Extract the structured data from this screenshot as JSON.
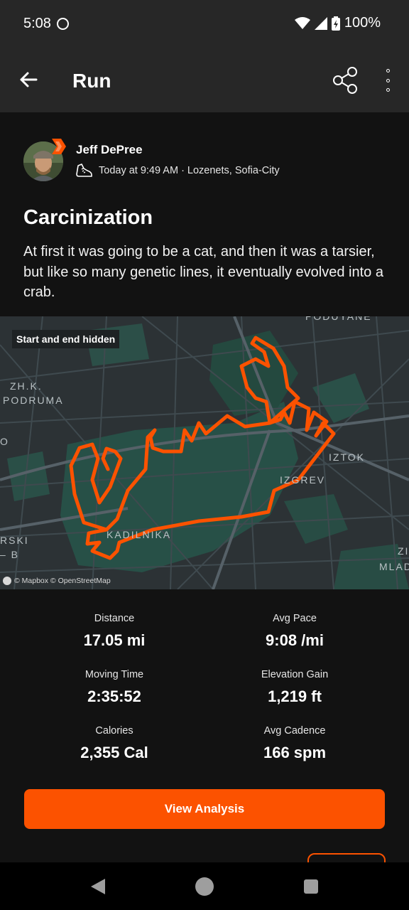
{
  "status_bar": {
    "time": "5:08",
    "battery": "100%"
  },
  "app_bar": {
    "title": "Run",
    "back_icon": "arrow-left-icon",
    "share_icon": "share-icon",
    "more_icon": "more-vertical-icon"
  },
  "athlete": {
    "name": "Jeff DePree",
    "activity_icon": "running-shoe-icon",
    "meta": "Today at 9:49 AM · Lozenets, Sofia-City"
  },
  "activity": {
    "title": "Carcinization",
    "description": "At first it was going to be a cat, and then it was a tarsier, but like so many genetic lines, it eventually evolved into a crab."
  },
  "map": {
    "privacy_chip": "Start and end hidden",
    "attribution": "© Mapbox © OpenStreetMap",
    "labels": {
      "zhk": "ZH.K.",
      "podruma": "PODRUMA",
      "podutane": "PODUYANE",
      "iztok": "IZTOK",
      "izgrev": "IZGREV",
      "kadilnika": "KADILNIKA",
      "rski": "RSKI",
      "b": "– B",
      "z": "ZI",
      "mla": "MLAD",
      "o": "O"
    },
    "route_color": "#fc5200"
  },
  "stats": [
    {
      "label": "Distance",
      "value": "17.05 mi"
    },
    {
      "label": "Avg Pace",
      "value": "9:08 /mi"
    },
    {
      "label": "Moving Time",
      "value": "2:35:52"
    },
    {
      "label": "Elevation Gain",
      "value": "1,219 ft"
    },
    {
      "label": "Calories",
      "value": "2,355 Cal"
    },
    {
      "label": "Avg Cadence",
      "value": "166 spm"
    }
  ],
  "actions": {
    "view_analysis": "View Analysis"
  },
  "colors": {
    "accent": "#fc5200",
    "background": "#121212",
    "app_bar": "#272727"
  }
}
